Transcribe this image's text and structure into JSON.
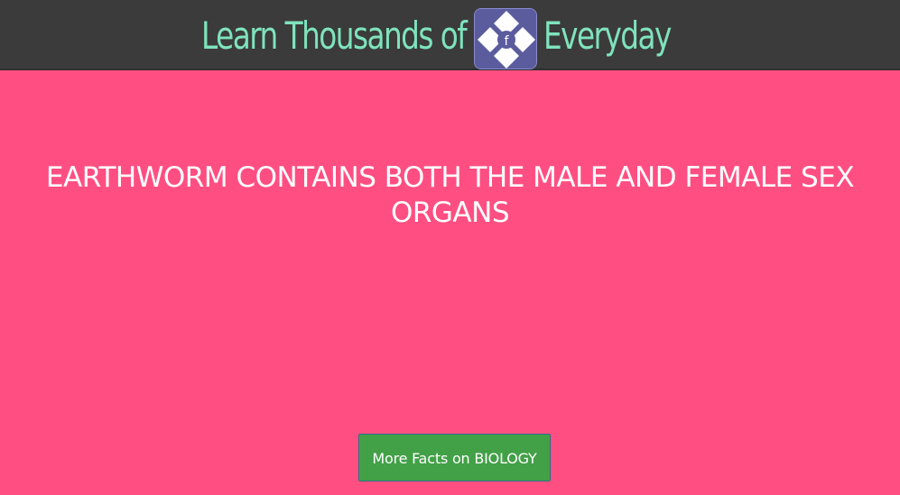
{
  "header": {
    "title_before": "Learn Thousands of",
    "title_after": "Everyday",
    "logo_letter": "f"
  },
  "main": {
    "fact": "EARTHWORM CONTAINS BOTH THE MALE AND FEMALE SEX ORGANS",
    "button_label": "More Facts on BIOLOGY"
  },
  "colors": {
    "background": "#ff4f82",
    "header_bg": "#3b3b3b",
    "header_text": "#7fe3bd",
    "logo_bg": "#5b5c9e",
    "button_bg": "#42a047"
  },
  "icons": {
    "logo": "fact-app-logo-icon"
  }
}
